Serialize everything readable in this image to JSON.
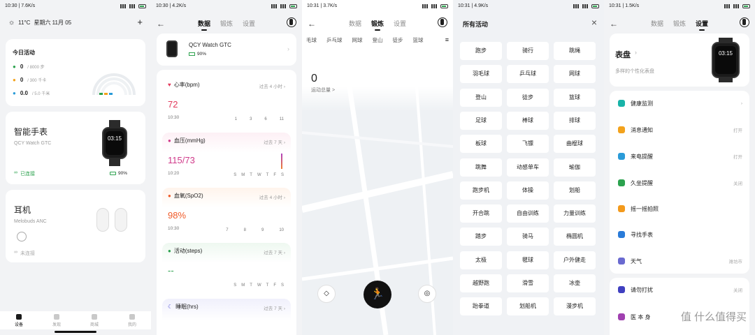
{
  "panel1": {
    "status": {
      "time": "10:30 | 7.6K/s"
    },
    "weather": {
      "temp": "11°C",
      "date": "星期六 11月 05",
      "add": "+"
    },
    "today": {
      "title": "今日活动",
      "rows": [
        {
          "value": "0",
          "target": "/ 8000 步"
        },
        {
          "value": "0",
          "target": "/ 300 千卡"
        },
        {
          "value": "0.0",
          "target": "/ 5.0 千米"
        }
      ]
    },
    "watch": {
      "title": "智能手表",
      "model": "QCY Watch GTC",
      "status": "已连接",
      "battery": "90%",
      "screen_time": "03:15"
    },
    "earbuds": {
      "title": "耳机",
      "model": "Melobuds ANC",
      "status": "未连接"
    },
    "nav": [
      {
        "label": "设备"
      },
      {
        "label": "发现"
      },
      {
        "label": "商城"
      },
      {
        "label": "我的"
      }
    ]
  },
  "panel2": {
    "status": {
      "time": "10:30 | 4.2K/s"
    },
    "tabs": [
      "数据",
      "锻炼",
      "设置"
    ],
    "device": {
      "name": "QCY Watch GTC",
      "battery": "90%"
    },
    "metrics": [
      {
        "title": "心率(bpm)",
        "range": "过去 4 小时",
        "value": "72",
        "time": "10:30",
        "axis": [
          "1",
          "3",
          "6",
          "11"
        ],
        "color": "#e23a5c"
      },
      {
        "title": "血压(mmHg)",
        "range": "过去 7 天",
        "value": "115/73",
        "time": "10:20",
        "axis": [
          "S",
          "M",
          "T",
          "W",
          "T",
          "F",
          "S"
        ],
        "color": "#d03a8a"
      },
      {
        "title": "血氧(SpO2)",
        "range": "过去 4 小时",
        "value": "98%",
        "time": "10:30",
        "axis": [
          "7",
          "8",
          "9",
          "10"
        ],
        "color": "#f05a28"
      },
      {
        "title": "活动(steps)",
        "range": "过去 7 天",
        "value": "--",
        "time": "",
        "axis": [
          "S",
          "M",
          "T",
          "W",
          "T",
          "F",
          "S"
        ],
        "color": "#2ca24e"
      },
      {
        "title": "睡眠(hrs)",
        "range": "过去 7 天",
        "value": "",
        "time": "",
        "axis": [],
        "color": "#3a3ad0"
      }
    ]
  },
  "panel3": {
    "status": {
      "time": "10:31 | 3.7K/s"
    },
    "tabs": [
      "数据",
      "锻炼",
      "设置"
    ],
    "sports": [
      "毛球",
      "乒乓球",
      "网球",
      "登山",
      "徒步",
      "篮球"
    ],
    "total": {
      "value": "0",
      "label": "运动总量 >"
    }
  },
  "panel4": {
    "status": {
      "time": "10:31 | 4.9K/s"
    },
    "title": "所有活动",
    "close": "×",
    "activities": [
      "跑步",
      "骑行",
      "跳绳",
      "羽毛球",
      "乒乓球",
      "网球",
      "登山",
      "徒步",
      "篮球",
      "足球",
      "棒球",
      "排球",
      "板球",
      "飞镖",
      "曲棍球",
      "跳舞",
      "动感单车",
      "瑜伽",
      "跑步机",
      "体操",
      "划船",
      "开合跳",
      "自由训练",
      "力量训练",
      "踏步",
      "骑马",
      "椭圆机",
      "太极",
      "毽球",
      "户外健走",
      "越野跑",
      "滑雪",
      "冰壶",
      "跆拳道",
      "划船机",
      "漫步机"
    ]
  },
  "panel5": {
    "status": {
      "time": "10:31 | 1.5K/s"
    },
    "tabs": [
      "数据",
      "锻炼",
      "设置"
    ],
    "face": {
      "title": "表盘",
      "subtitle": "多样的个性化表盘",
      "screen_time": "03:15"
    },
    "rows": [
      {
        "label": "健康监测",
        "right": "",
        "color": "#18b3a8"
      },
      {
        "label": "消息通知",
        "right": "打开",
        "color": "#f3a21c"
      },
      {
        "label": "来电提醒",
        "right": "打开",
        "color": "#2a9bd8"
      },
      {
        "label": "久坐提醒",
        "right": "关闭",
        "color": "#2ca24e"
      },
      {
        "label": "摇一摇拍照",
        "right": "",
        "color": "#f39a1c"
      },
      {
        "label": "寻找手表",
        "right": "",
        "color": "#2a7bd8"
      },
      {
        "label": "天气",
        "right": "潍坊市",
        "color": "#6a6ad0"
      },
      {
        "label": "请勿打扰",
        "right": "关闭",
        "color": "#4040c0"
      },
      {
        "label": "医 本 身",
        "right": "",
        "color": "#a040b0"
      }
    ],
    "watermark": "值 什么值得买"
  }
}
